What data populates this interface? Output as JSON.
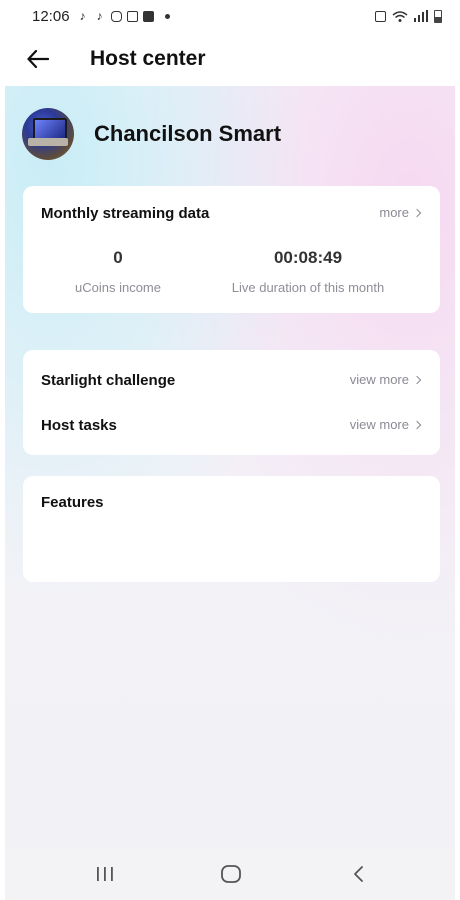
{
  "status_bar": {
    "time": "12:06",
    "icons_left": [
      "tiktok-icon",
      "tiktok-icon",
      "instagram-icon",
      "gallery-icon",
      "checkbox-icon",
      "dot-icon"
    ],
    "icons_right": [
      "sim-lock-icon",
      "wifi-icon",
      "signal-icon",
      "battery-icon"
    ]
  },
  "app_bar": {
    "back_icon": "arrow-left-icon",
    "title": "Host center"
  },
  "profile": {
    "name": "Chancilson Smart"
  },
  "streaming_card": {
    "title": "Monthly streaming data",
    "more_label": "more",
    "stats": [
      {
        "value": "0",
        "label": "uCoins income"
      },
      {
        "value": "00:08:49",
        "label": "Live duration of this month"
      }
    ]
  },
  "links_card": {
    "items": [
      {
        "title": "Starlight challenge",
        "action": "view more"
      },
      {
        "title": "Host tasks",
        "action": "view more"
      }
    ]
  },
  "features_card": {
    "title": "Features"
  },
  "nav_bar": {
    "buttons": [
      "recent-apps-icon",
      "home-icon",
      "back-icon"
    ]
  }
}
